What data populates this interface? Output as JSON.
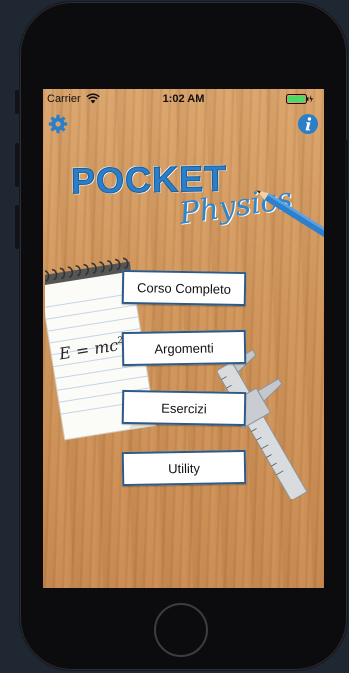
{
  "status_bar": {
    "carrier": "Carrier",
    "time": "1:02 AM",
    "wifi_icon": "wifi-icon",
    "battery_icon": "battery-icon"
  },
  "toolbar": {
    "settings_icon": "gear-icon",
    "info_icon": "info-icon"
  },
  "logo": {
    "line1": "POCKET",
    "line2": "Physics"
  },
  "notepad": {
    "formula_lhs": "E = mc",
    "formula_exp": "2"
  },
  "menu": {
    "items": [
      {
        "label": "Corso Completo"
      },
      {
        "label": "Argomenti"
      },
      {
        "label": "Esercizi"
      },
      {
        "label": "Utility"
      }
    ]
  },
  "colors": {
    "accent_blue": "#2b7fc9",
    "button_border": "#2d5a86",
    "battery_green": "#4cd964",
    "wood": "#cf9459",
    "device_bg": "#1f2733"
  }
}
